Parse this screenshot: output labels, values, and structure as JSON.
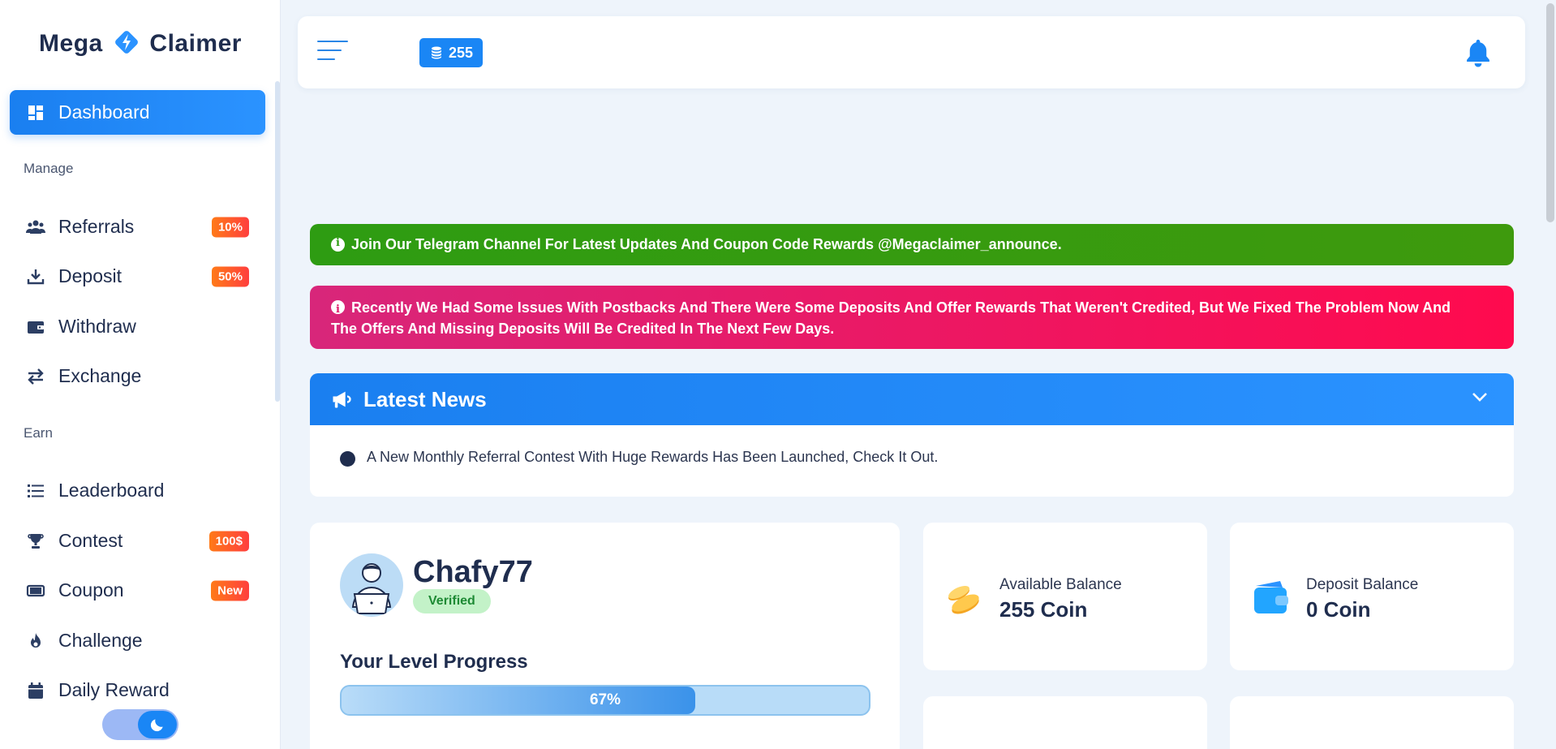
{
  "brand": {
    "name_left": "Mega",
    "name_right": "Claimer"
  },
  "sidebar": {
    "active_item": {
      "label": "Dashboard",
      "icon": "dashboard-icon"
    },
    "sections": {
      "manage": "Manage",
      "earn": "Earn"
    },
    "manage_items": [
      {
        "label": "Referrals",
        "icon": "users-icon",
        "badge": "10%"
      },
      {
        "label": "Deposit",
        "icon": "download-icon",
        "badge": "50%"
      },
      {
        "label": "Withdraw",
        "icon": "wallet-icon",
        "badge": ""
      },
      {
        "label": "Exchange",
        "icon": "exchange-icon",
        "badge": ""
      }
    ],
    "earn_items": [
      {
        "label": "Leaderboard",
        "icon": "list-icon",
        "badge": ""
      },
      {
        "label": "Contest",
        "icon": "trophy-icon",
        "badge": "100$"
      },
      {
        "label": "Coupon",
        "icon": "ticket-icon",
        "badge": "New"
      },
      {
        "label": "Challenge",
        "icon": "fire-icon",
        "badge": ""
      },
      {
        "label": "Daily Reward",
        "icon": "calendar-icon",
        "badge": ""
      }
    ]
  },
  "topbar": {
    "coin_count": "255",
    "coin_icon": "coins-icon",
    "bell_icon": "bell-icon"
  },
  "alerts": {
    "telegram": "Join Our Telegram Channel For Latest Updates And Coupon Code Rewards @Megaclaimer_announce.",
    "postbacks_line1": "Recently We Had Some Issues With Postbacks And There Were Some Deposits And Offer Rewards That Weren't Credited, But We Fixed The Problem Now And",
    "postbacks_line2": "The Offers And Missing Deposits Will Be Credited In The Next Few Days."
  },
  "news": {
    "title": "Latest News",
    "items": [
      "A New Monthly Referral Contest With Huge Rewards Has Been Launched, Check It Out."
    ]
  },
  "profile": {
    "username": "Chafy77",
    "status": "Verified",
    "level_title": "Your Level Progress",
    "level_progress": 67,
    "level_progress_label": "67%"
  },
  "balances": {
    "available": {
      "label": "Available Balance",
      "value": "255 Coin"
    },
    "deposit": {
      "label": "Deposit Balance",
      "value": "0 Coin"
    }
  },
  "colors": {
    "primary": "#1a86f5",
    "green_alert": "#2e9c12",
    "pink_alert": "#ff0a4e",
    "badge_orange": "#ff5a2a",
    "text_dark": "#1f2d4e"
  }
}
